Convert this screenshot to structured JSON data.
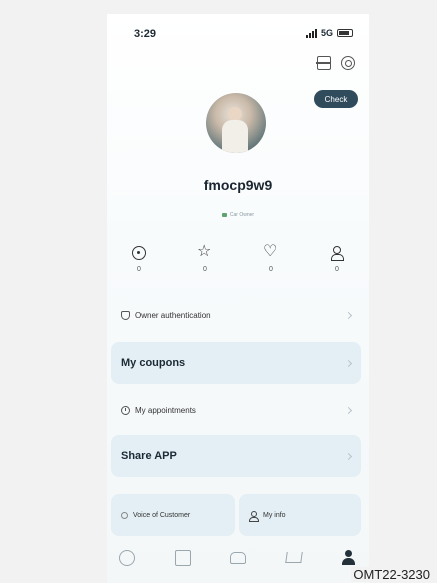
{
  "status_bar": {
    "time": "3:29",
    "network": "5G"
  },
  "profile": {
    "username": "fmocp9w9",
    "tag": "Car Owner",
    "checkin_label": "Check"
  },
  "stats": [
    {
      "icon": "plus-circle-icon",
      "value": "0"
    },
    {
      "icon": "star-icon",
      "value": "0"
    },
    {
      "icon": "heart-icon",
      "value": "0"
    },
    {
      "icon": "users-icon",
      "value": "0"
    }
  ],
  "menu": {
    "owner_auth": "Owner authentication",
    "coupons": "My coupons",
    "appointments": "My appointments",
    "share": "Share APP",
    "voice": "Voice of Customer",
    "info": "My info"
  },
  "tabs": [
    "compass-icon",
    "message-icon",
    "car-icon",
    "cart-icon",
    "profile-icon"
  ],
  "watermark": "OMT22-3230",
  "colors": {
    "accent": "#2f4b5c",
    "card": "#e3eff4",
    "tag": "#5fa36e"
  }
}
